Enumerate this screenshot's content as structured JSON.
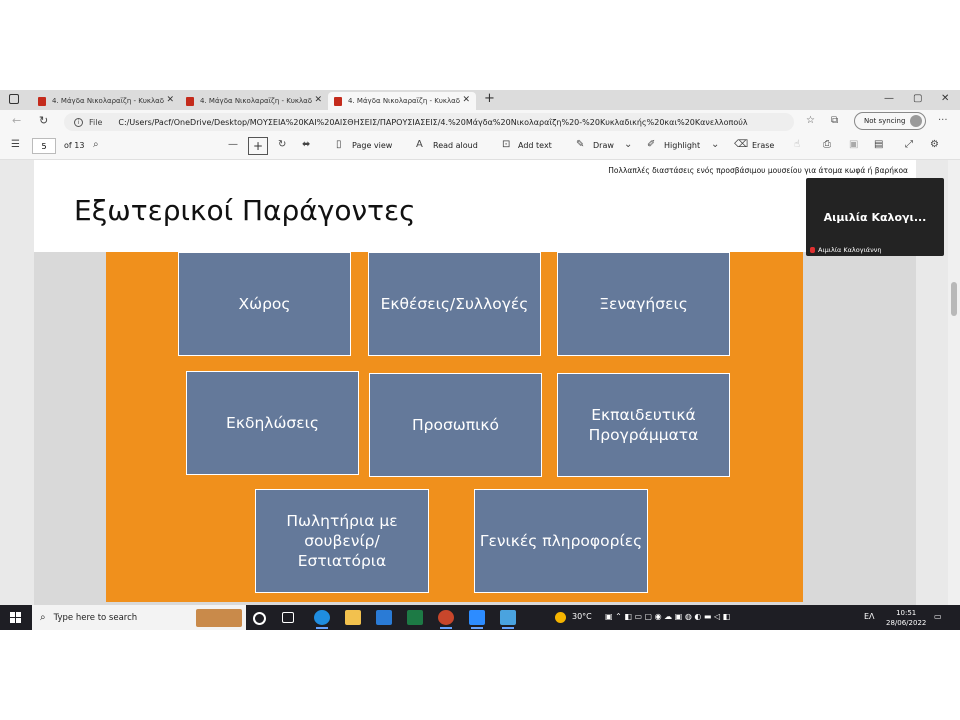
{
  "browser": {
    "tabs": [
      {
        "title": "4. Μάγδα Νικολαραΐζη - Κυκλαδ",
        "active": false
      },
      {
        "title": "4. Μάγδα Νικολαραΐζη - Κυκλαδ",
        "active": false
      },
      {
        "title": "4. Μάγδα Νικολαραΐζη - Κυκλαδ",
        "active": true
      }
    ],
    "address": {
      "scheme_label": "File",
      "url": "C:/Users/Pacf/OneDrive/Desktop/ΜΟΥΣΕΙΑ%20ΚΑΙ%20ΑΙΣΘΗΣΕΙΣ/ΠΑΡΟΥΣΙΑΣΕΙΣ/4.%20Μάγδα%20Νικολαραΐζη%20-%20Κυκλαδικής%20και%20Κανελλοπούλο..."
    },
    "sync_label": "Not syncing"
  },
  "pdf_toolbar": {
    "current_page": "5",
    "page_count": "of 13",
    "page_view": "Page view",
    "read_aloud": "Read aloud",
    "add_text": "Add text",
    "draw": "Draw",
    "highlight": "Highlight",
    "erase": "Erase"
  },
  "slide": {
    "header_text": "Πολλαπλές διαστάσεις ενός προσβάσιμου μουσείου για άτομα κωφά ή βαρήκοα",
    "title": "Εξωτερικοί Παράγοντες",
    "boxes": [
      "Χώρος",
      "Εκθέσεις/Συλλογές",
      "Ξεναγήσεις",
      "Εκδηλώσεις",
      "Προσωπικό",
      "Εκπαιδευτικά Προγράμματα",
      "Πωλητήρια με σουβενίρ/Εστιατόρια",
      "Γενικές πληροφορίες"
    ],
    "colors": {
      "background": "#f0901c",
      "box": "#64799a"
    }
  },
  "video": {
    "name_display": "Αιμιλία Καλογι...",
    "label": "Αιμιλία Καλογιάννη"
  },
  "taskbar": {
    "search_placeholder": "Type here to search",
    "weather": "30°C",
    "language": "ΕΛ",
    "time": "10:51",
    "date": "28/06/2022"
  }
}
